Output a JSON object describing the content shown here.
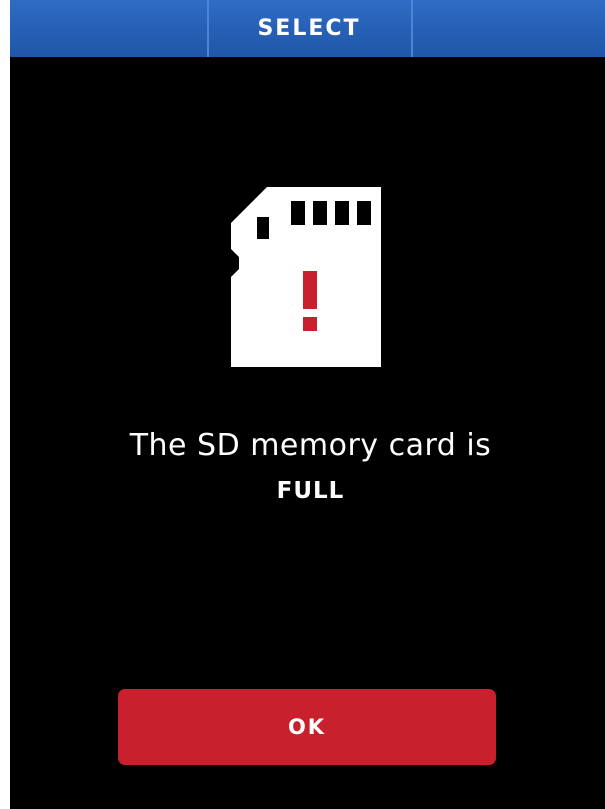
{
  "header": {
    "title": "SELECT"
  },
  "dialog": {
    "icon": "sd-card-warning-icon",
    "message": "The SD memory card is",
    "status": "FULL",
    "ok_label": "OK"
  },
  "colors": {
    "header_blue": "#2a62b8",
    "background": "#000000",
    "button_red": "#c8202c",
    "icon_white": "#ffffff",
    "exclamation_red": "#c8202c"
  }
}
